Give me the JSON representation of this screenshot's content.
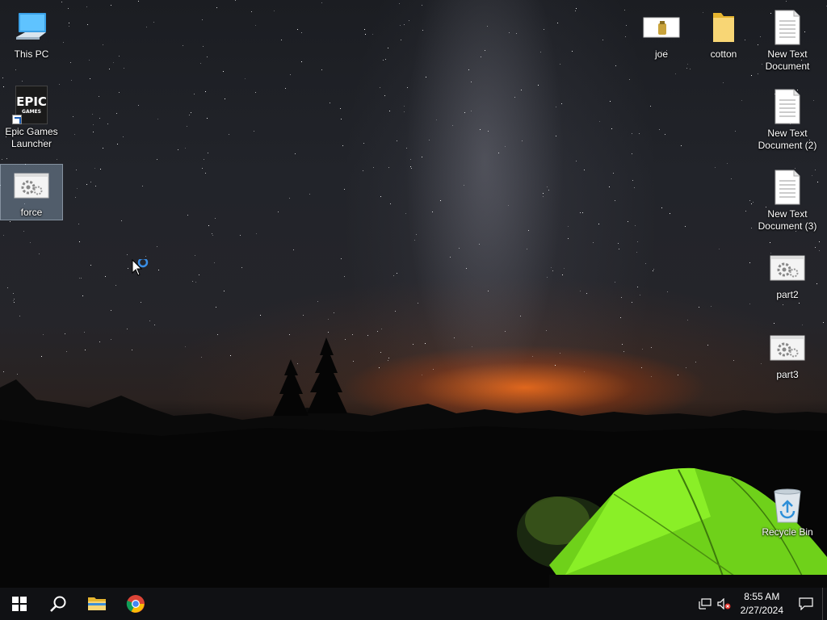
{
  "desktop": {
    "icons_left": [
      {
        "label": "This PC"
      },
      {
        "label": "Epic Games Launcher",
        "logo_text": "EPIC GAMES"
      },
      {
        "label": "force"
      }
    ],
    "icons_right": [
      {
        "label": "joe"
      },
      {
        "label": "cotton"
      },
      {
        "label": "New Text Document"
      },
      {
        "label": "New Text Document (2)"
      },
      {
        "label": "New Text Document (3)"
      },
      {
        "label": "part2"
      },
      {
        "label": "part3"
      },
      {
        "label": "Recycle Bin"
      }
    ]
  },
  "taskbar": {
    "pinned": [
      "windows-start-icon",
      "search-icon",
      "file-explorer-icon",
      "chrome-icon"
    ],
    "clock": {
      "time": "8:55 AM",
      "date": "2/27/2024"
    }
  },
  "colors": {
    "taskbar": "#101114",
    "selection": "#aac8e6",
    "start_icon": "#ffffff",
    "folder": "#f3c74e",
    "tent": "#7ef21c"
  }
}
